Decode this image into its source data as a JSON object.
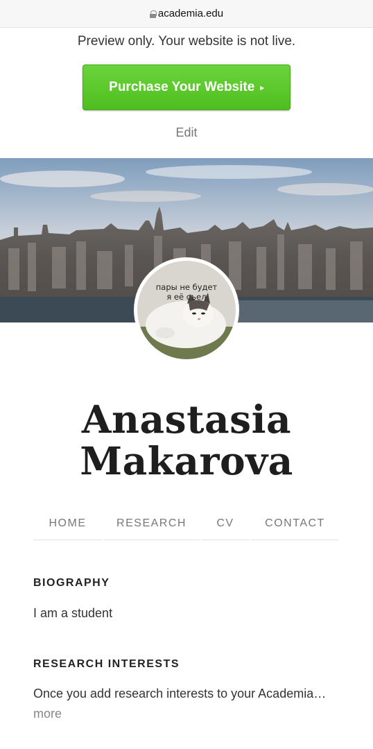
{
  "browser": {
    "url": "academia.edu"
  },
  "banner": {
    "preview_note": "Preview only. Your website is not live.",
    "purchase_label": "Purchase Your Website",
    "purchase_arrow": "▸",
    "edit_label": "Edit"
  },
  "profile": {
    "avatar_caption_line1": "пары не будет",
    "avatar_caption_line2": "я её съел",
    "first_name": "Anastasia",
    "last_name": "Makarova"
  },
  "nav": [
    {
      "label": "HOME"
    },
    {
      "label": "RESEARCH"
    },
    {
      "label": "CV"
    },
    {
      "label": "CONTACT"
    }
  ],
  "biography": {
    "title": "BIOGRAPHY",
    "text": "I am a student"
  },
  "research_interests": {
    "title": "RESEARCH INTERESTS",
    "text": "Once you add research interests to your Academia…",
    "more": "more"
  },
  "colors": {
    "accent_green": "#5cc92b",
    "text_dark": "#1e1e1e",
    "muted": "#777777"
  }
}
